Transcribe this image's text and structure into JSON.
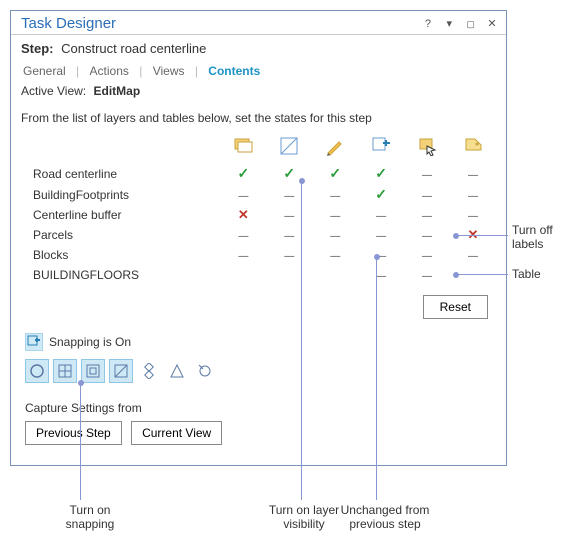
{
  "titlebar": {
    "title": "Task Designer"
  },
  "step": {
    "label": "Step:",
    "name": "Construct road centerline"
  },
  "tabs": {
    "items": [
      "General",
      "Actions",
      "Views",
      "Contents"
    ],
    "active": "Contents"
  },
  "active_view": {
    "label": "Active View:",
    "value": "EditMap"
  },
  "instructions": "From the list of layers and tables below, set the states for this step",
  "columns": [
    {
      "id": "listbylayer",
      "name": "list-by-layer-icon"
    },
    {
      "id": "visibility",
      "name": "visibility-icon"
    },
    {
      "id": "editable",
      "name": "editable-icon"
    },
    {
      "id": "snapping",
      "name": "snapping-icon"
    },
    {
      "id": "selectable",
      "name": "selectable-icon"
    },
    {
      "id": "labels",
      "name": "labels-icon"
    }
  ],
  "layers": [
    {
      "name": "Road centerline",
      "cells": [
        "check",
        "check",
        "check",
        "check",
        "dash",
        "dash"
      ]
    },
    {
      "name": "BuildingFootprints",
      "cells": [
        "dash",
        "dash",
        "dash",
        "check",
        "dash",
        "dash"
      ]
    },
    {
      "name": "Centerline buffer",
      "cells": [
        "cross",
        "dash",
        "dash",
        "dash",
        "dash",
        "dash"
      ]
    },
    {
      "name": "Parcels",
      "cells": [
        "dash",
        "dash",
        "dash",
        "dash",
        "dash",
        "cross"
      ]
    },
    {
      "name": "Blocks",
      "cells": [
        "dash",
        "dash",
        "dash",
        "dash",
        "dash",
        "dash"
      ]
    },
    {
      "name": "BUILDINGFLOORS",
      "cells": [
        "",
        "",
        "",
        "dash",
        "dash",
        ""
      ]
    }
  ],
  "reset_label": "Reset",
  "snapping": {
    "label": "Snapping is On"
  },
  "snap_tools": [
    {
      "name": "point-snap-icon",
      "selected": true
    },
    {
      "name": "intersection-snap-icon",
      "selected": true
    },
    {
      "name": "endpoint-snap-icon",
      "selected": true
    },
    {
      "name": "edge-snap-icon",
      "selected": true
    },
    {
      "name": "vertex-snap-icon",
      "selected": false
    },
    {
      "name": "midpoint-snap-icon",
      "selected": false
    },
    {
      "name": "tangent-snap-icon",
      "selected": false
    }
  ],
  "capture": {
    "label": "Capture Settings from",
    "previous": "Previous Step",
    "current": "Current View"
  },
  "annotations": {
    "turn_off_labels_1": "Turn off",
    "turn_off_labels_2": "labels",
    "table": "Table",
    "turn_on_snapping_1": "Turn on",
    "turn_on_snapping_2": "snapping",
    "turn_on_vis_1": "Turn on layer",
    "turn_on_vis_2": "visibility",
    "unchanged_1": "Unchanged from",
    "unchanged_2": "previous step"
  }
}
